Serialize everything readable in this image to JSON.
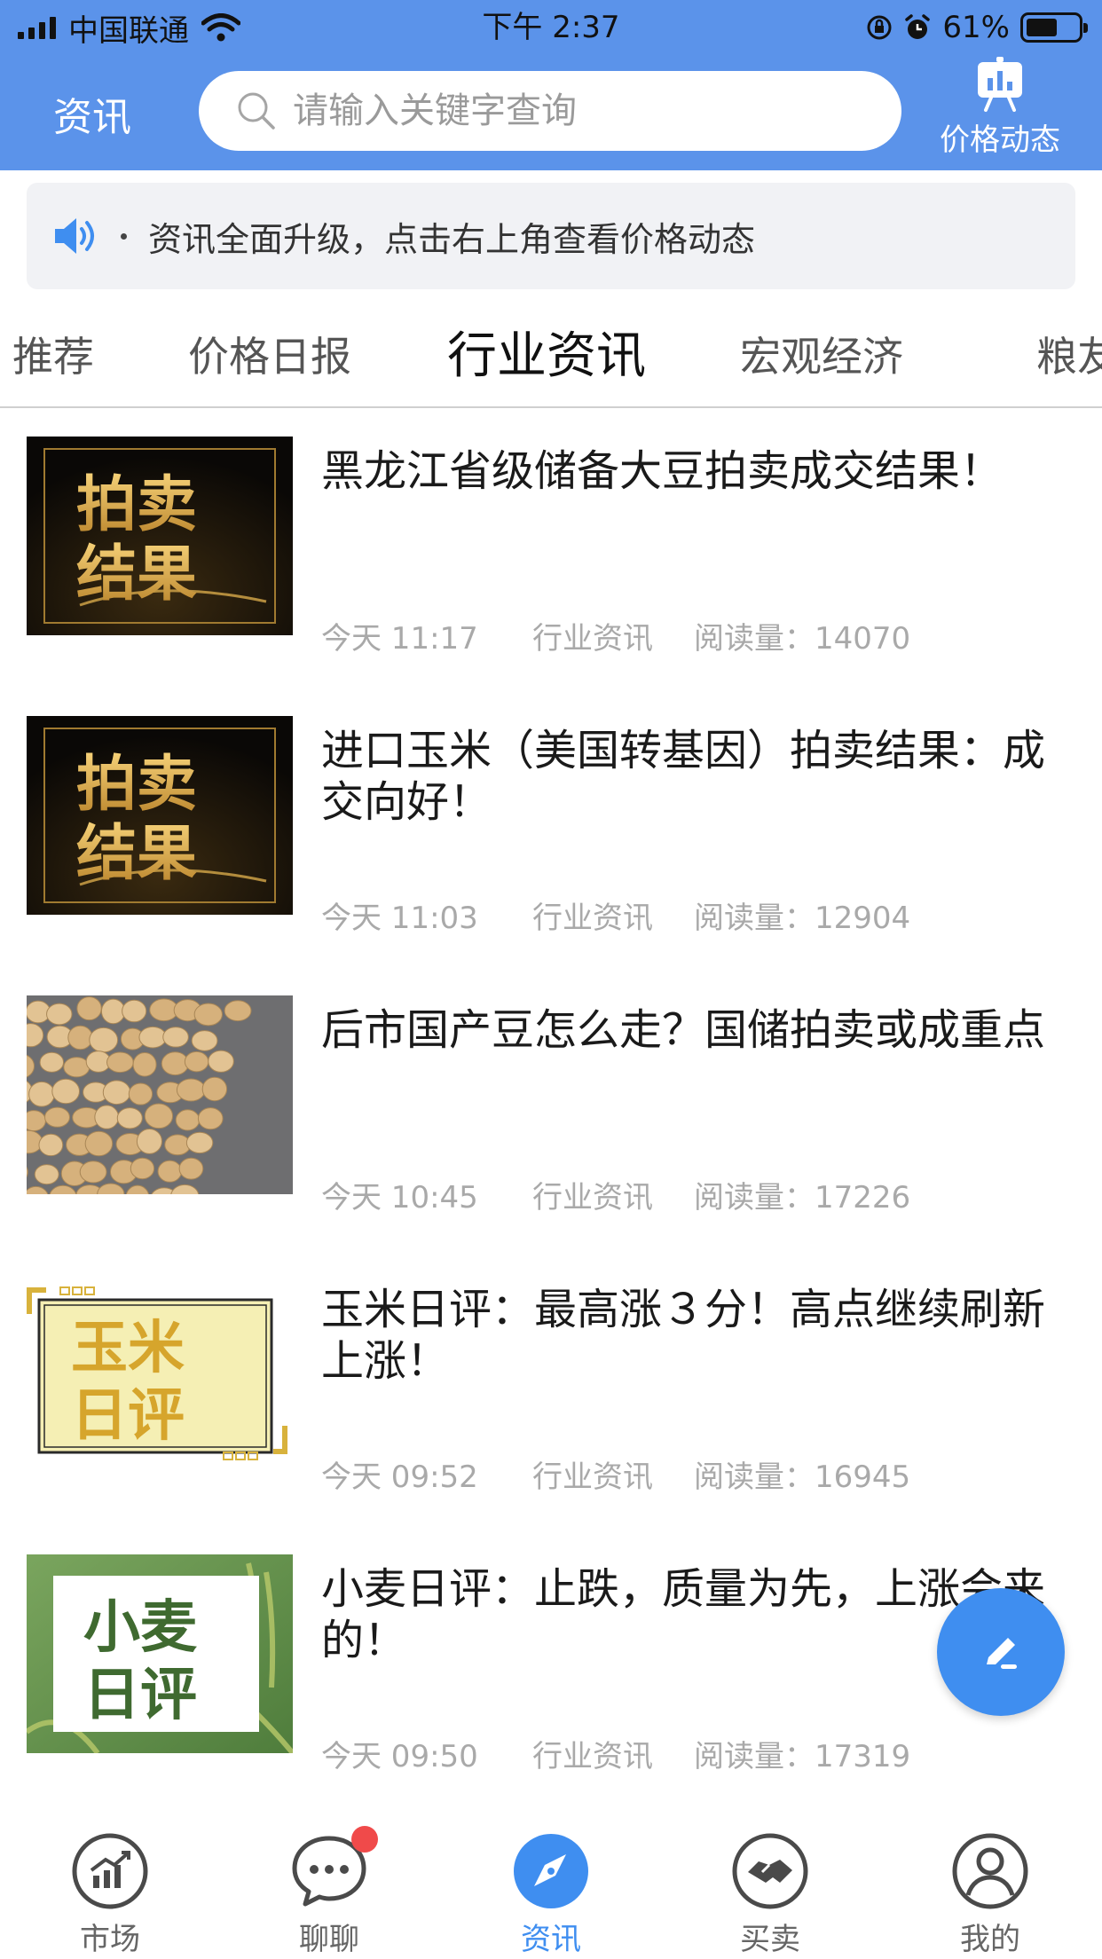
{
  "status_bar": {
    "carrier": "中国联通",
    "time": "下午 2:37",
    "battery": "61%",
    "battery_level": 0.61
  },
  "header": {
    "title": "资讯",
    "search_placeholder": "请输入关键字查询",
    "price_button_label": "价格动态",
    "icons": [
      "search-icon",
      "bar-chart-icon"
    ]
  },
  "notice": {
    "text": "资讯全面升级，点击右上角查看价格动态",
    "icon": "speaker-icon"
  },
  "tabs": [
    {
      "label": "推荐",
      "active": false
    },
    {
      "label": "价格日报",
      "active": false
    },
    {
      "label": "行业资讯",
      "active": true
    },
    {
      "label": "宏观经济",
      "active": false
    },
    {
      "label": "粮友",
      "active": false
    }
  ],
  "news": [
    {
      "title": "黑龙江省级储备大豆拍卖成交结果！",
      "time": "今天 11:17",
      "category": "行业资讯",
      "reads": "阅读量：14070",
      "thumb_text": [
        "拍卖",
        "结果"
      ]
    },
    {
      "title": "进口玉米（美国转基因）拍卖结果：成交向好！",
      "time": "今天 11:03",
      "category": "行业资讯",
      "reads": "阅读量：12904",
      "thumb_text": [
        "拍卖",
        "结果"
      ]
    },
    {
      "title": "后市国产豆怎么走？国储拍卖或成重点",
      "time": "今天 10:45",
      "category": "行业资讯",
      "reads": "阅读量：17226",
      "thumb_text": []
    },
    {
      "title": "玉米日评：最高涨３分！高点继续刷新上涨！",
      "time": "今天 09:52",
      "category": "行业资讯",
      "reads": "阅读量：16945",
      "thumb_text": [
        "玉米",
        "日评"
      ]
    },
    {
      "title": "小麦日评：止跌，质量为先，上涨会来的！",
      "time": "今天 09:50",
      "category": "行业资讯",
      "reads": "阅读量：17319",
      "thumb_text": [
        "小麦",
        "日评"
      ]
    }
  ],
  "fab": {
    "icon": "edit-icon"
  },
  "tabbar": [
    {
      "label": "市场",
      "icon": "market-icon",
      "active": false
    },
    {
      "label": "聊聊",
      "icon": "chat-icon",
      "active": false,
      "badge": true
    },
    {
      "label": "资讯",
      "icon": "compass-icon",
      "active": true
    },
    {
      "label": "买卖",
      "icon": "handshake-icon",
      "active": false
    },
    {
      "label": "我的",
      "icon": "user-icon",
      "active": false
    }
  ],
  "colors": {
    "header_bg": "#5b93ea",
    "accent": "#3f8ef0",
    "badge": "#f04a4a",
    "meta_text": "#a9a9a9"
  }
}
